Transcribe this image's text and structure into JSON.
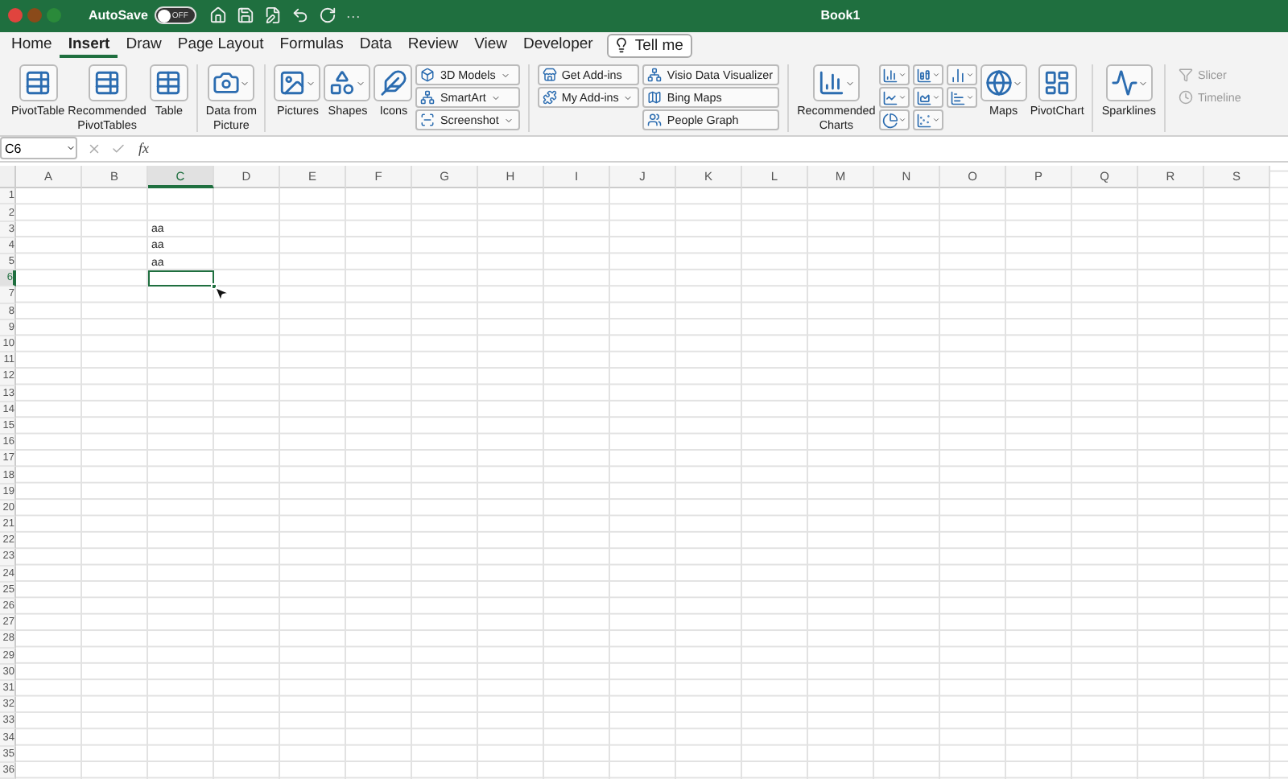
{
  "title_bar": {
    "autosave_label": "AutoSave",
    "autosave": {
      "on": false,
      "label": "OFF"
    },
    "more": "···",
    "title": "Book1"
  },
  "tabs": [
    {
      "label": "Home",
      "selected": false
    },
    {
      "label": "Insert",
      "selected": true
    },
    {
      "label": "Draw",
      "selected": false
    },
    {
      "label": "Page Layout",
      "selected": false
    },
    {
      "label": "Formulas",
      "selected": false
    },
    {
      "label": "Data",
      "selected": false
    },
    {
      "label": "Review",
      "selected": false
    },
    {
      "label": "View",
      "selected": false
    },
    {
      "label": "Developer",
      "selected": false
    }
  ],
  "tell_me": "Tell me",
  "ribbon": [
    {
      "items": [
        {
          "kind": "large",
          "label": "PivotTable",
          "dropdown": false
        },
        {
          "kind": "large",
          "label": "Recommended\nPivotTables",
          "dropdown": false
        },
        {
          "kind": "large",
          "label": "Table",
          "dropdown": false
        }
      ]
    },
    {
      "items": [
        {
          "kind": "large",
          "label": "Data from\nPicture",
          "dropdown": true
        }
      ]
    },
    {
      "items": [
        {
          "kind": "large",
          "label": "Pictures",
          "dropdown": true
        },
        {
          "kind": "large",
          "label": "Shapes",
          "dropdown": true
        },
        {
          "kind": "large",
          "label": "Icons",
          "dropdown": false
        },
        {
          "kind": "stack",
          "buttons": [
            {
              "label": "3D Models",
              "dropdown": true
            },
            {
              "label": "SmartArt",
              "dropdown": true
            },
            {
              "label": "Screenshot",
              "dropdown": true
            }
          ]
        }
      ]
    },
    {
      "items": [
        {
          "kind": "stack",
          "buttons": [
            {
              "label": "Get Add-ins",
              "dropdown": false
            },
            {
              "label": "My Add-ins",
              "dropdown": true
            }
          ]
        },
        {
          "kind": "stack",
          "buttons": [
            {
              "label": "Visio Data Visualizer",
              "dropdown": false
            },
            {
              "label": "Bing Maps",
              "dropdown": false
            },
            {
              "label": "People Graph",
              "dropdown": false
            }
          ]
        }
      ]
    },
    {
      "items": [
        {
          "kind": "large",
          "label": "Recommended\nCharts",
          "dropdown": true
        },
        {
          "kind": "chartgrid"
        },
        {
          "kind": "large",
          "label": "Maps",
          "dropdown": true
        },
        {
          "kind": "large",
          "label": "PivotChart",
          "dropdown": false
        }
      ]
    },
    {
      "items": [
        {
          "kind": "large",
          "label": "Sparklines",
          "dropdown": true
        }
      ]
    },
    {
      "items": [
        {
          "kind": "stack",
          "buttons": [
            {
              "label": "Slicer",
              "dropdown": false,
              "disabled": true
            },
            {
              "label": "Timeline",
              "dropdown": false,
              "disabled": true
            }
          ]
        }
      ]
    }
  ],
  "formula_bar": {
    "name_box": "C6",
    "fx": "fx"
  },
  "sheet": {
    "columns": [
      {
        "label": "A",
        "selected": false
      },
      {
        "label": "B",
        "selected": false
      },
      {
        "label": "C",
        "selected": true
      },
      {
        "label": "D",
        "selected": false
      },
      {
        "label": "E",
        "selected": false
      },
      {
        "label": "F",
        "selected": false
      },
      {
        "label": "G",
        "selected": false
      },
      {
        "label": "H",
        "selected": false
      },
      {
        "label": "I",
        "selected": false
      },
      {
        "label": "J",
        "selected": false
      },
      {
        "label": "K",
        "selected": false
      },
      {
        "label": "L",
        "selected": false
      },
      {
        "label": "M",
        "selected": false
      },
      {
        "label": "N",
        "selected": false
      },
      {
        "label": "O",
        "selected": false
      },
      {
        "label": "P",
        "selected": false
      },
      {
        "label": "Q",
        "selected": false
      },
      {
        "label": "R",
        "selected": false
      },
      {
        "label": "S",
        "selected": false
      }
    ],
    "rows": [
      {
        "label": "1",
        "selected": false
      },
      {
        "label": "2",
        "selected": false
      },
      {
        "label": "3",
        "selected": false,
        "cells": [
          null,
          null,
          "aa"
        ]
      },
      {
        "label": "4",
        "selected": false,
        "cells": [
          null,
          null,
          "aa"
        ]
      },
      {
        "label": "5",
        "selected": false,
        "cells": [
          null,
          null,
          "aa"
        ]
      },
      {
        "label": "6",
        "selected": true
      },
      {
        "label": "7",
        "selected": false
      },
      {
        "label": "8",
        "selected": false
      },
      {
        "label": "9",
        "selected": false
      },
      {
        "label": "10",
        "selected": false
      },
      {
        "label": "11",
        "selected": false
      },
      {
        "label": "12",
        "selected": false
      },
      {
        "label": "13",
        "selected": false
      },
      {
        "label": "14",
        "selected": false
      },
      {
        "label": "15",
        "selected": false
      },
      {
        "label": "16",
        "selected": false
      },
      {
        "label": "17",
        "selected": false
      },
      {
        "label": "18",
        "selected": false
      },
      {
        "label": "19",
        "selected": false
      },
      {
        "label": "20",
        "selected": false
      },
      {
        "label": "21",
        "selected": false
      },
      {
        "label": "22",
        "selected": false
      },
      {
        "label": "23",
        "selected": false
      },
      {
        "label": "24",
        "selected": false
      },
      {
        "label": "25",
        "selected": false
      },
      {
        "label": "26",
        "selected": false
      },
      {
        "label": "27",
        "selected": false
      },
      {
        "label": "28",
        "selected": false
      },
      {
        "label": "29",
        "selected": false
      },
      {
        "label": "30",
        "selected": false
      },
      {
        "label": "31",
        "selected": false
      },
      {
        "label": "32",
        "selected": false
      },
      {
        "label": "33",
        "selected": false
      },
      {
        "label": "34",
        "selected": false
      },
      {
        "label": "35",
        "selected": false
      },
      {
        "label": "36",
        "selected": false
      }
    ]
  }
}
